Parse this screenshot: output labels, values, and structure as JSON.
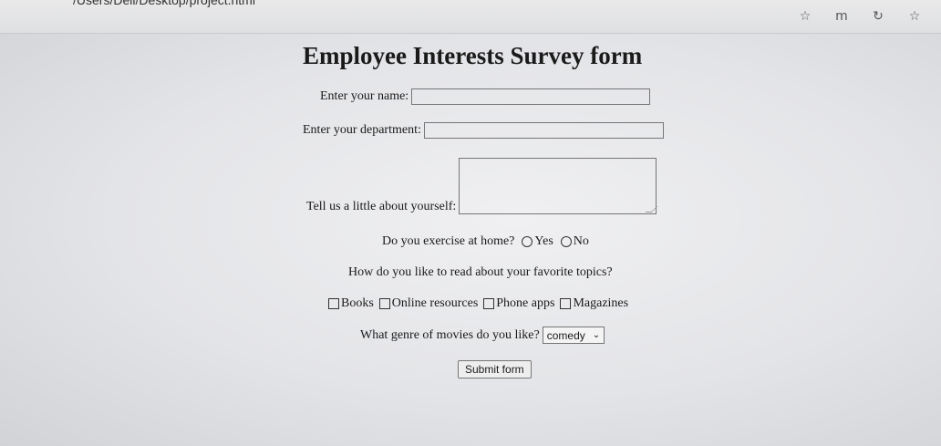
{
  "browser": {
    "url": "/Users/Dell/Desktop/project.html",
    "icons": [
      "reader-icon",
      "extension-icon",
      "refresh-icon",
      "favorite-icon"
    ]
  },
  "form": {
    "title": "Employee Interests Survey form",
    "name_label": "Enter your name:",
    "department_label": "Enter your department:",
    "about_label": "Tell us a little about yourself:",
    "exercise_question": "Do you exercise at home?",
    "exercise_options": [
      "Yes",
      "No"
    ],
    "read_question": "How do you like to read about your favorite topics?",
    "read_options": [
      "Books",
      "Online resources",
      "Phone apps",
      "Magazines"
    ],
    "genre_question": "What genre of movies do you like?",
    "genre_selected": "comedy",
    "submit_label": "Submit form"
  }
}
